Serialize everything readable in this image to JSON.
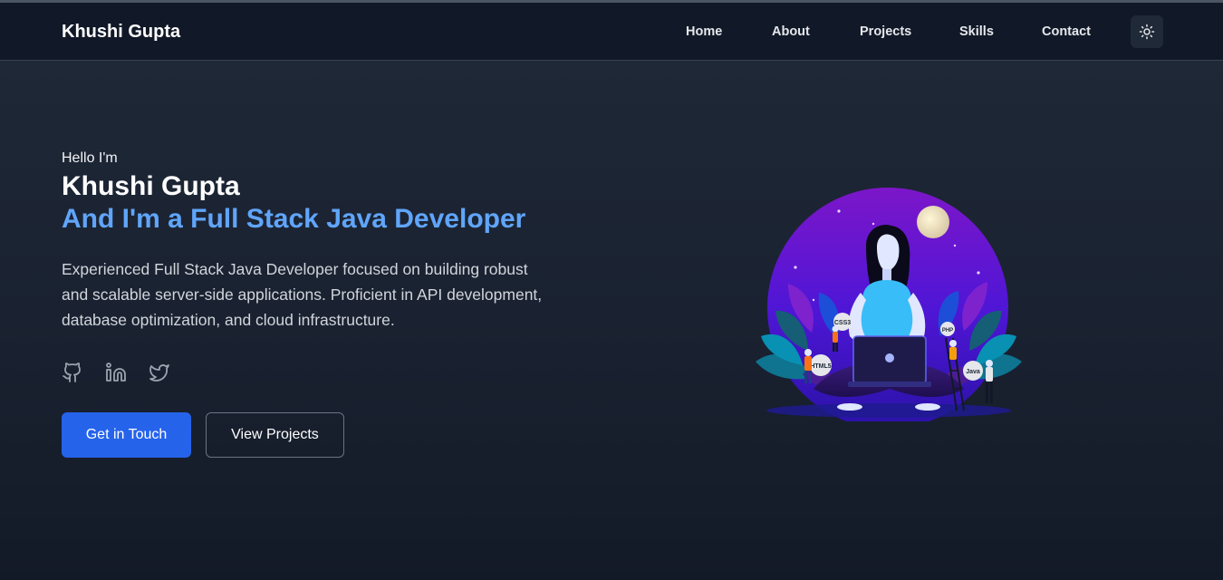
{
  "nav": {
    "brand": "Khushi Gupta",
    "links": [
      {
        "label": "Home"
      },
      {
        "label": "About"
      },
      {
        "label": "Projects"
      },
      {
        "label": "Skills"
      },
      {
        "label": "Contact"
      }
    ],
    "theme_toggle_icon": "sun-icon"
  },
  "hero": {
    "greeting": "Hello I'm",
    "name": "Khushi Gupta",
    "role": "And I'm a Full Stack Java Developer",
    "description": "Experienced Full Stack Java Developer focused on building robust and scalable server-side applications. Proficient in API development, database optimization, and cloud infrastructure.",
    "socials": [
      {
        "icon": "github-icon"
      },
      {
        "icon": "linkedin-icon"
      },
      {
        "icon": "twitter-icon"
      }
    ],
    "primary_button": "Get in Touch",
    "secondary_button": "View Projects",
    "illustration": {
      "badges": [
        "CSS3",
        "PHP",
        "HTML5",
        "Java"
      ]
    }
  },
  "colors": {
    "accent": "#60a5fa",
    "primary_button": "#2563eb",
    "nav_background": "#111827",
    "page_background": "#1f2937"
  }
}
